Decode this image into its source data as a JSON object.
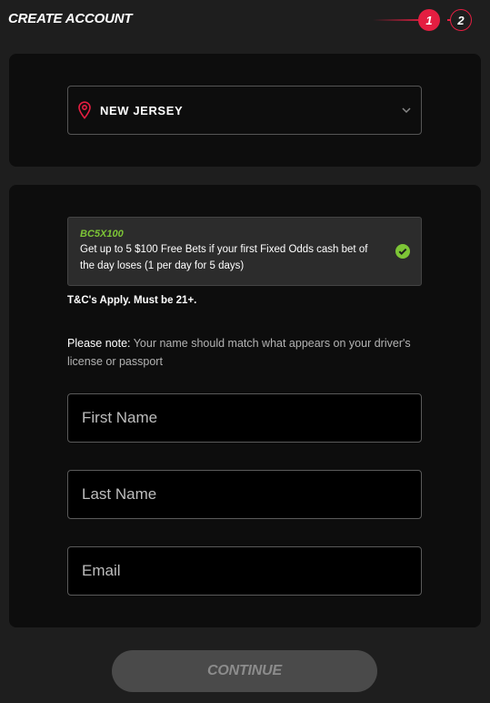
{
  "header": {
    "title": "CREATE ACCOUNT",
    "steps": [
      "1",
      "2"
    ],
    "active_step": 1
  },
  "state_select": {
    "value": "NEW JERSEY",
    "icon": "location-pin-icon"
  },
  "promo": {
    "code": "BC5X100",
    "description": "Get up to 5 $100 Free Bets if your first Fixed Odds cash bet of the day loses (1 per day for 5 days)",
    "icon": "check-circle-icon"
  },
  "terms": "T&C's Apply. Must be 21+.",
  "note": {
    "label": "Please note:",
    "text": " Your name should match what appears on your driver's license or passport"
  },
  "form": {
    "first_name_placeholder": "First Name",
    "last_name_placeholder": "Last Name",
    "email_placeholder": "Email"
  },
  "continue_label": "CONTINUE",
  "colors": {
    "accent": "#e41e41",
    "promo_green": "#7dc536",
    "background": "#1e1e1e",
    "card": "#0d0d0d"
  }
}
